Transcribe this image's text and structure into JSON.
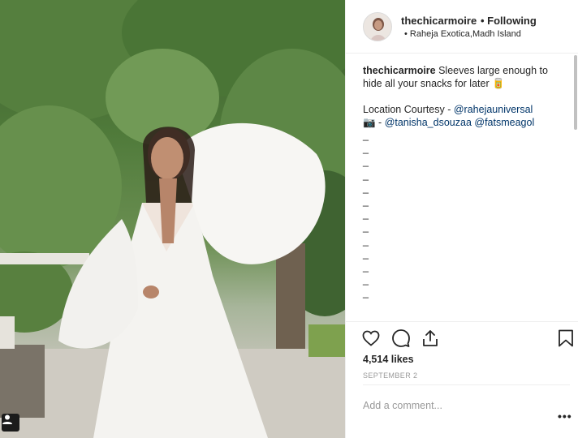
{
  "post": {
    "username": "thechicarmoire",
    "follow_status": "• Following",
    "location": "• Raheja Exotica,Madh Island",
    "caption_user": "thechicarmoire",
    "caption_text": " Sleeves large enough to hide all your snacks for later ",
    "caption_emoji": "🥫",
    "location_courtesy_label": "Location Courtesy - ",
    "location_courtesy_mention": "@rahejauniversal",
    "camera_emoji": "📷",
    "credit_sep": " - ",
    "credit_mention_1": "@tanisha_dsouzaa",
    "credit_mention_2": "@fatsmeagol",
    "dashes": [
      "_",
      "_",
      "_",
      "_",
      "_",
      "_",
      "_",
      "_",
      "_",
      "_",
      "_",
      "_",
      "_"
    ],
    "likes": "4,514 likes",
    "date": "SEPTEMBER 2",
    "comment_placeholder": "Add a comment...",
    "more_label": "•••"
  },
  "icons": {
    "like": "heart-icon",
    "comment": "comment-icon",
    "share": "share-icon",
    "save": "bookmark-icon",
    "tag": "user-tag-icon"
  }
}
